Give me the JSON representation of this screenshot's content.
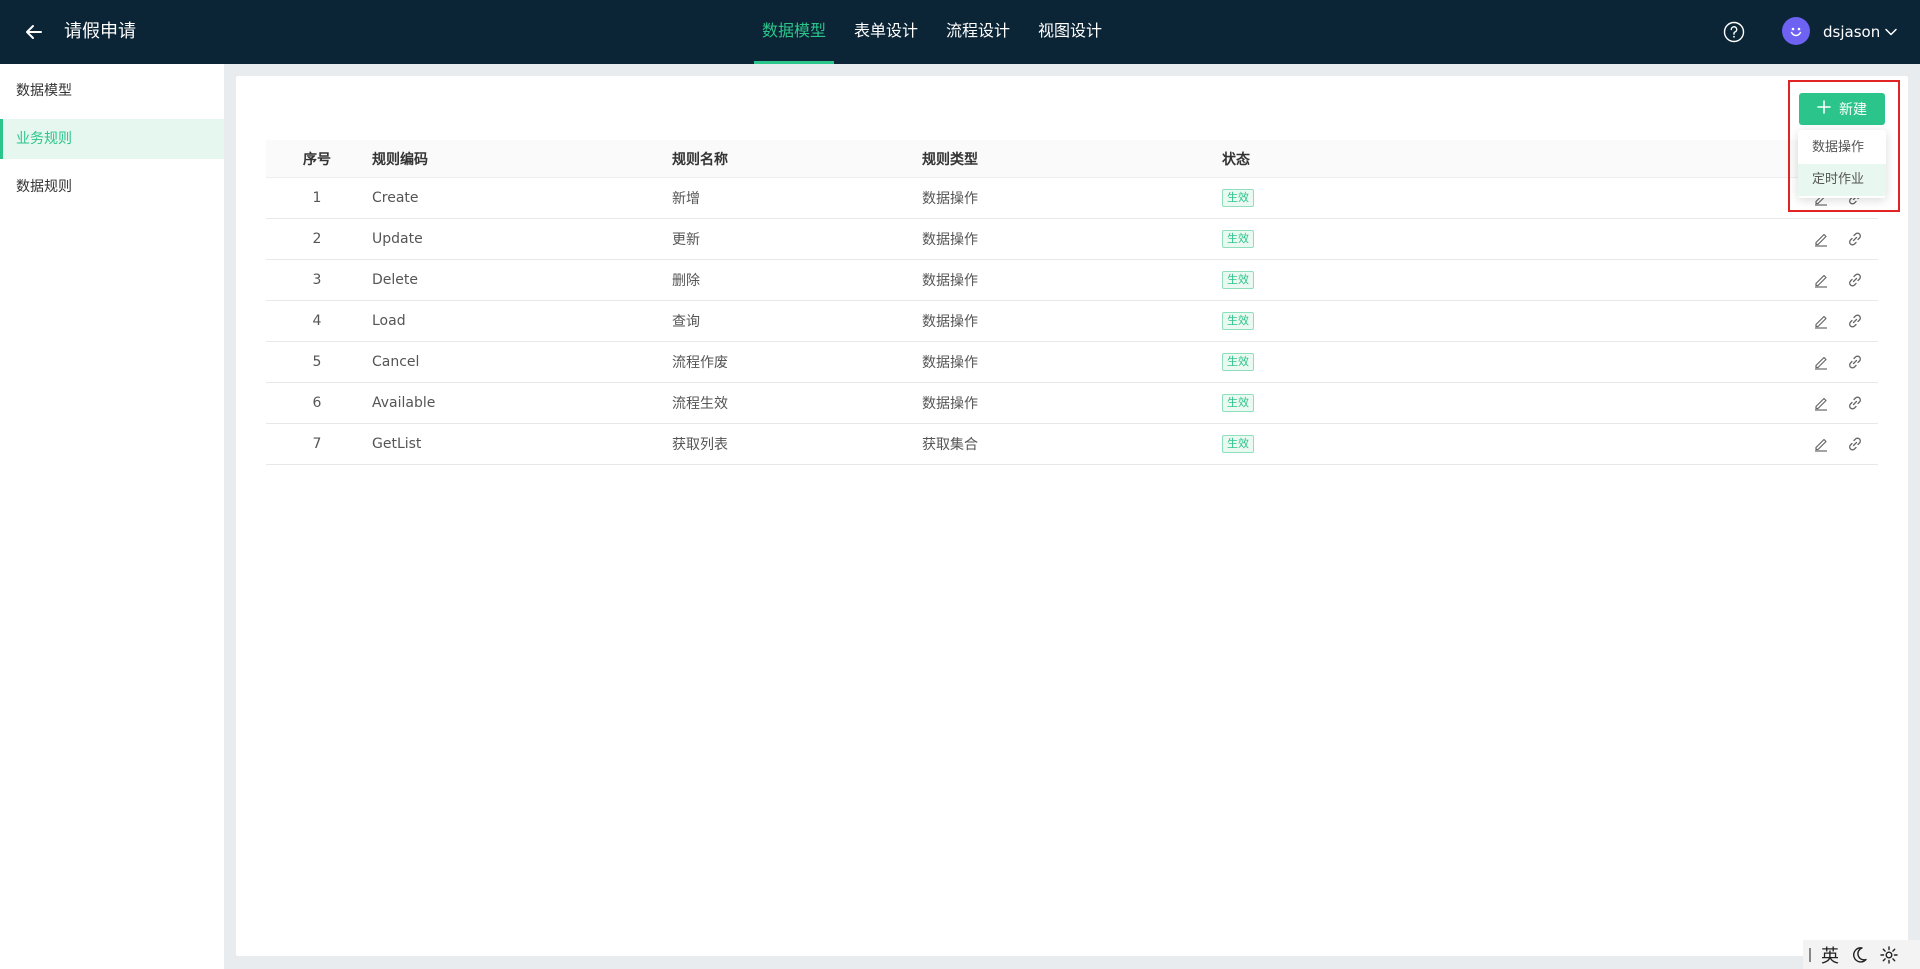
{
  "header": {
    "title": "请假申请",
    "tabs": [
      {
        "label": "数据模型",
        "active": true
      },
      {
        "label": "表单设计",
        "active": false
      },
      {
        "label": "流程设计",
        "active": false
      },
      {
        "label": "视图设计",
        "active": false
      }
    ],
    "username": "dsjason"
  },
  "sidebar": {
    "items": [
      {
        "label": "数据模型",
        "active": false
      },
      {
        "label": "业务规则",
        "active": true
      },
      {
        "label": "数据规则",
        "active": false
      }
    ]
  },
  "toolbar": {
    "new_label": "新建",
    "dropdown": [
      "数据操作",
      "定时作业"
    ]
  },
  "table": {
    "columns": [
      "序号",
      "规则编码",
      "规则名称",
      "规则类型",
      "状态"
    ],
    "rows": [
      {
        "idx": "1",
        "code": "Create",
        "name": "新增",
        "type": "数据操作",
        "status": "生效"
      },
      {
        "idx": "2",
        "code": "Update",
        "name": "更新",
        "type": "数据操作",
        "status": "生效"
      },
      {
        "idx": "3",
        "code": "Delete",
        "name": "删除",
        "type": "数据操作",
        "status": "生效"
      },
      {
        "idx": "4",
        "code": "Load",
        "name": "查询",
        "type": "数据操作",
        "status": "生效"
      },
      {
        "idx": "5",
        "code": "Cancel",
        "name": "流程作废",
        "type": "数据操作",
        "status": "生效"
      },
      {
        "idx": "6",
        "code": "Available",
        "name": "流程生效",
        "type": "数据操作",
        "status": "生效"
      },
      {
        "idx": "7",
        "code": "GetList",
        "name": "获取列表",
        "type": "获取集合",
        "status": "生效"
      }
    ]
  },
  "floatbar": {
    "ime_label": "英"
  },
  "colors": {
    "topbar_bg": "#0c2536",
    "accent": "#2bc48a",
    "highlight": "#e02424"
  }
}
